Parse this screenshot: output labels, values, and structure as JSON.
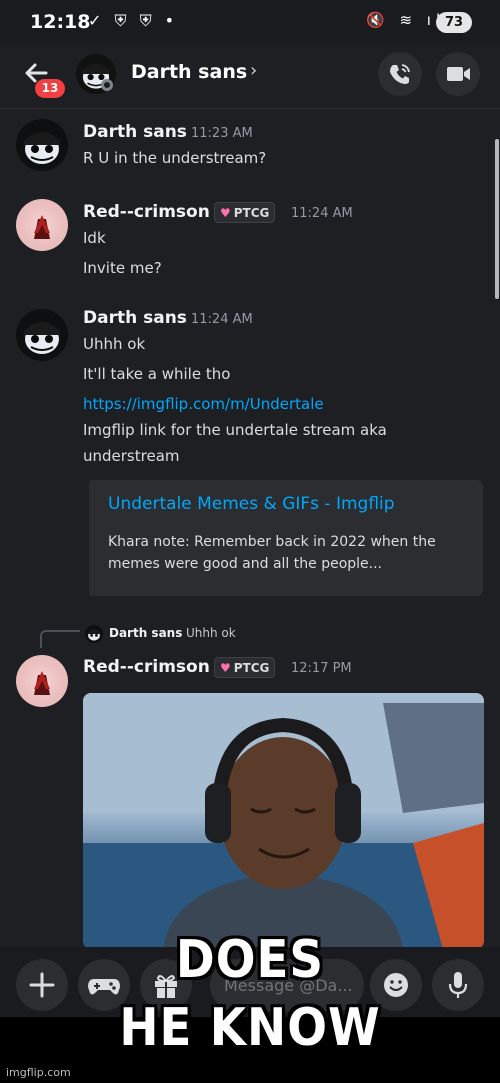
{
  "status_bar": {
    "time": "12:18",
    "left_icons": "✓ ⛨ ⛨ •",
    "right_icons": "🔇 ≋ ıl",
    "battery": "73"
  },
  "header": {
    "title": "Darth sans",
    "chevron": "›",
    "unread_badge": "13",
    "call_icon": "phone-icon",
    "video_icon": "video-icon"
  },
  "messages": [
    {
      "author": "Darth sans",
      "time": "11:23 AM",
      "lines": [
        "R U in the understream?"
      ]
    },
    {
      "author": "Red--crimson",
      "tag": "PTCG",
      "time": "11:24 AM",
      "lines": [
        "Idk",
        "Invite me?"
      ]
    },
    {
      "author": "Darth sans",
      "time": "11:24 AM",
      "lines": [
        "Uhhh ok",
        "It'll take a while tho"
      ],
      "link": "https://imgflip.com/m/Undertale",
      "link_text_1": "Imgflip link for the undertale stream aka",
      "link_text_2": "understream",
      "embed": {
        "title": "Undertale Memes & GIFs - Imgflip",
        "description": "Khara note: Remember back in 2022 when the memes were good and all the people..."
      }
    },
    {
      "reply_to_author": "Darth sans",
      "reply_to_text": "Uhhh ok",
      "author": "Red--crimson",
      "tag": "PTCG",
      "time": "12:17 PM"
    }
  ],
  "composer": {
    "placeholder": "Message @Da...",
    "plus_icon": "plus-icon",
    "apps_icon": "gamepad-icon",
    "gift_icon": "gift-icon",
    "emoji_icon": "emoji-icon",
    "mic_icon": "microphone-icon"
  },
  "meme": {
    "caption_line_1": "DOES",
    "caption_line_2": "HE KNOW",
    "watermark": "imgflip.com"
  },
  "colors": {
    "background": "#1e1f22",
    "link": "#00a8fc",
    "badge": "#f23f42"
  }
}
